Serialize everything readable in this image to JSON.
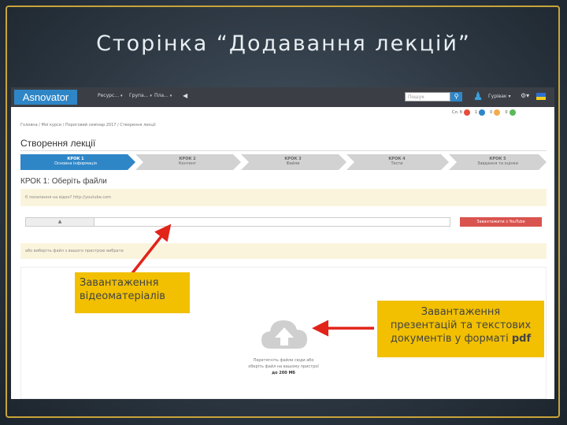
{
  "slide": {
    "title": "Сторінка “Додавання лекцій”"
  },
  "app": {
    "logo": "Asnovator",
    "menu": [
      {
        "label": "Ресурс..."
      },
      {
        "label": "Група..."
      },
      {
        "label": "Пла..."
      }
    ],
    "search_placeholder": "Пошук",
    "user": "Гурівак",
    "stats": [
      {
        "label": "Сл. б",
        "value": "1",
        "color": "#e74c3c"
      },
      {
        "label": "1",
        "value": "",
        "color": "#2f86c7"
      },
      {
        "label": "0",
        "value": "",
        "color": "#f0ad4e"
      },
      {
        "label": "0",
        "value": "",
        "color": "#5cb85c"
      }
    ]
  },
  "breadcrumb": "Головна / Мої курси / Пороговий семінар 2017 / Створення лекції",
  "page_title": "Створення лекції",
  "steps": [
    {
      "num": "КРОК 1",
      "name": "Основна інформація",
      "active": true
    },
    {
      "num": "КРОК 2",
      "name": "Контент",
      "active": false
    },
    {
      "num": "КРОК 3",
      "name": "Файли",
      "active": false
    },
    {
      "num": "КРОК 4",
      "name": "Тести",
      "active": false
    },
    {
      "num": "КРОК 5",
      "name": "Завдання та оцінки",
      "active": false
    }
  ],
  "step1_heading": "КРОК 1: Оберіть файли",
  "video_info": "Є посилання на відео? http://youtube.com",
  "upload_label": "▲",
  "youtube_button": "Завантажити з YouTube",
  "file_info": "або виберіть файл з вашого пристрою вибрати",
  "dropzone": {
    "line1": "Перетягніть файли сюди або",
    "line2": "оберіть файл на вашому пристрої",
    "line3": "до 200 Мб"
  },
  "annotations": {
    "video": "Завантаження відеоматеріалів",
    "docs_line1": "Завантаження",
    "docs_line2": "презентацій та текстових",
    "docs_line3": "документів у форматі ",
    "docs_bold": "pdf"
  }
}
